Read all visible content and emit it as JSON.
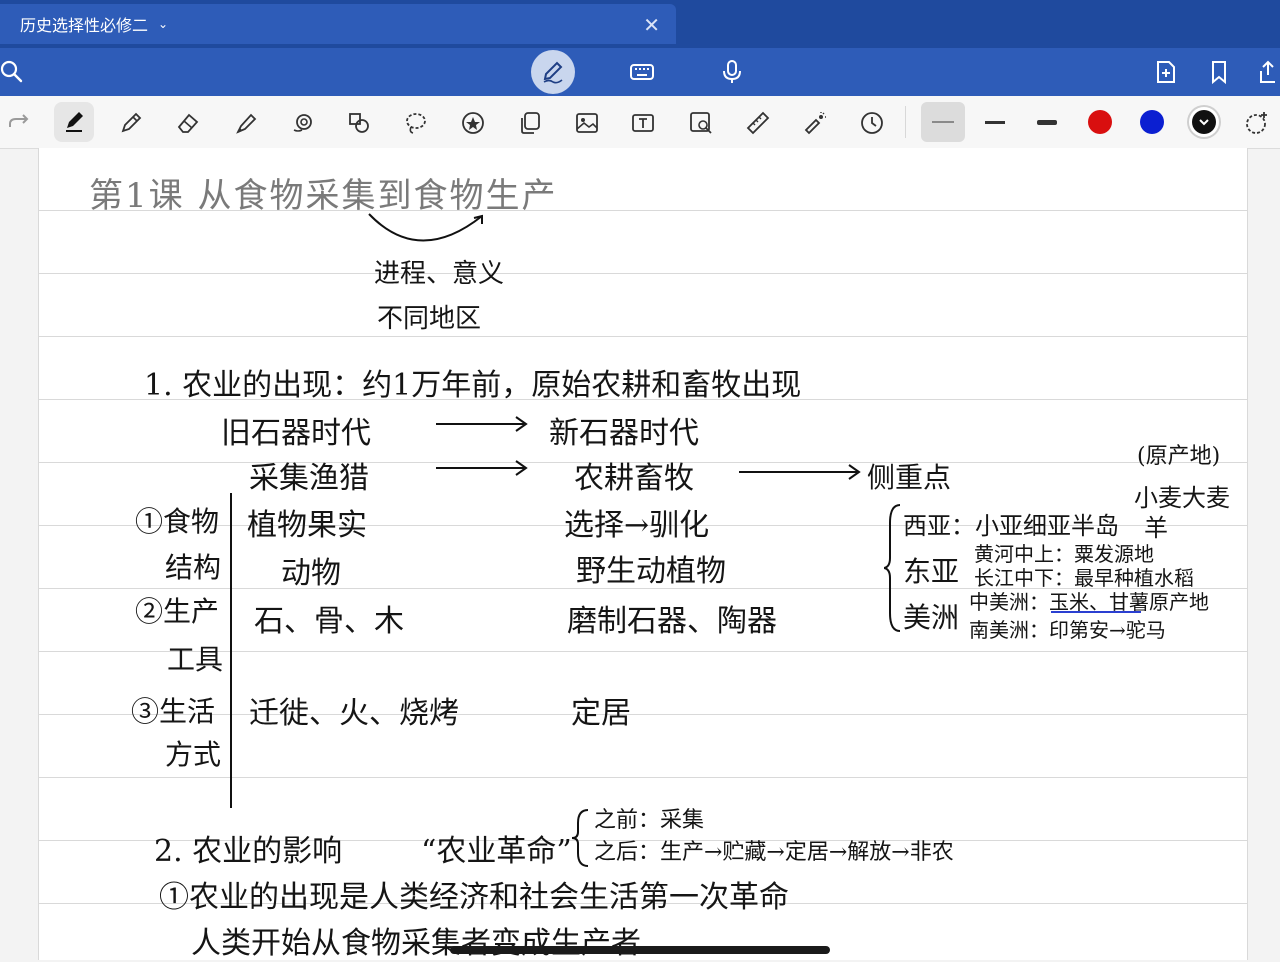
{
  "app": {
    "tab_title": "历史选择性必修二",
    "tab_chevron": "⌄",
    "tab_close": "✕"
  },
  "toolbar": {
    "colors": [
      "#d90f0f",
      "#0b1fd1",
      "#111111"
    ],
    "selected_color": "#111111"
  },
  "note": {
    "title": "第1课 从食物采集到食物生产",
    "title_notes": [
      "进程、意义",
      "不同地区"
    ],
    "section1": {
      "heading": "1. 农业的出现：约1万年前，原始农耕和畜牧出现",
      "row_age_left": "旧石器时代",
      "row_age_right": "新石器时代",
      "row_mode_left": "采集渔猎",
      "row_mode_right": "农耕畜牧",
      "row_mode_far": "侧重点",
      "labels": {
        "food_1": "①食物",
        "food_2": "结构",
        "tools_1": "②生产",
        "tools_2": "工具",
        "life_1": "③生活",
        "life_2": "方式"
      },
      "old": {
        "food_plant": "植物果实",
        "food_animal": "动物",
        "tools": "石、骨、木",
        "life": "迁徙、火、烧烤"
      },
      "new": {
        "food_plant": "选择→驯化",
        "food_animal": "野生动植物",
        "tools": "磨制石器、陶器",
        "life": "定居"
      },
      "regions": {
        "origin_note": "(原产地)",
        "west_asia": "西亚：小亚细亚半岛",
        "west_asia_items": [
          "小麦大麦",
          "羊"
        ],
        "east_asia": "东亚",
        "east_asia_items": [
          "黄河中上：粟发源地",
          "长江中下：最早种植水稻"
        ],
        "americas": "美洲",
        "americas_items": [
          "中美洲：玉米、甘薯原产地",
          "南美洲：印第安→驼马"
        ]
      }
    },
    "section2": {
      "heading": "2. 农业的影响",
      "revolution": "“农业革命”",
      "before": "之前：采集",
      "after": "之后：生产→贮藏→定居→解放→非农",
      "point1": "①农业的出现是人类经济和社会生活第一次革命",
      "point1b": "人类开始从食物采集者变成生产者"
    }
  }
}
